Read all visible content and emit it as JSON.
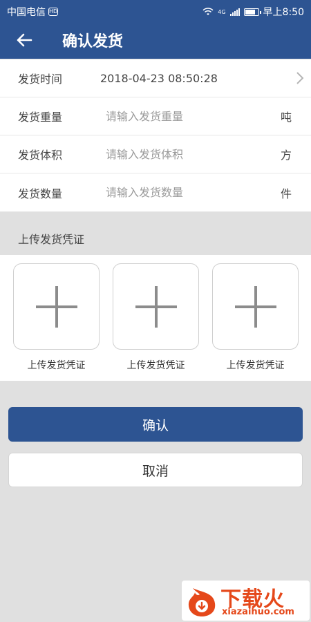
{
  "status_bar": {
    "carrier": "中国电信",
    "hd_badge": "HD",
    "network": "4G",
    "time": "早上8:50"
  },
  "header": {
    "title": "确认发货",
    "back_icon": "arrow-left-icon"
  },
  "form": {
    "ship_time": {
      "label": "发货时间",
      "value": "2018-04-23 08:50:28"
    },
    "weight": {
      "label": "发货重量",
      "placeholder": "请输入发货重量",
      "unit": "吨"
    },
    "volume": {
      "label": "发货体积",
      "placeholder": "请输入发货体积",
      "unit": "方"
    },
    "quantity": {
      "label": "发货数量",
      "placeholder": "请输入发货数量",
      "unit": "件"
    }
  },
  "upload": {
    "section_title": "上传发货凭证",
    "slots": [
      {
        "caption": "上传发货凭证",
        "icon": "plus-icon"
      },
      {
        "caption": "上传发货凭证",
        "icon": "plus-icon"
      },
      {
        "caption": "上传发货凭证",
        "icon": "plus-icon"
      }
    ]
  },
  "actions": {
    "confirm_label": "确认",
    "cancel_label": "取消"
  },
  "watermark": {
    "brand": "下载火",
    "domain": "xiazaihuo.com"
  },
  "colors": {
    "primary": "#2d5492",
    "background": "#e0e0e0",
    "watermark": "#e5481a"
  }
}
